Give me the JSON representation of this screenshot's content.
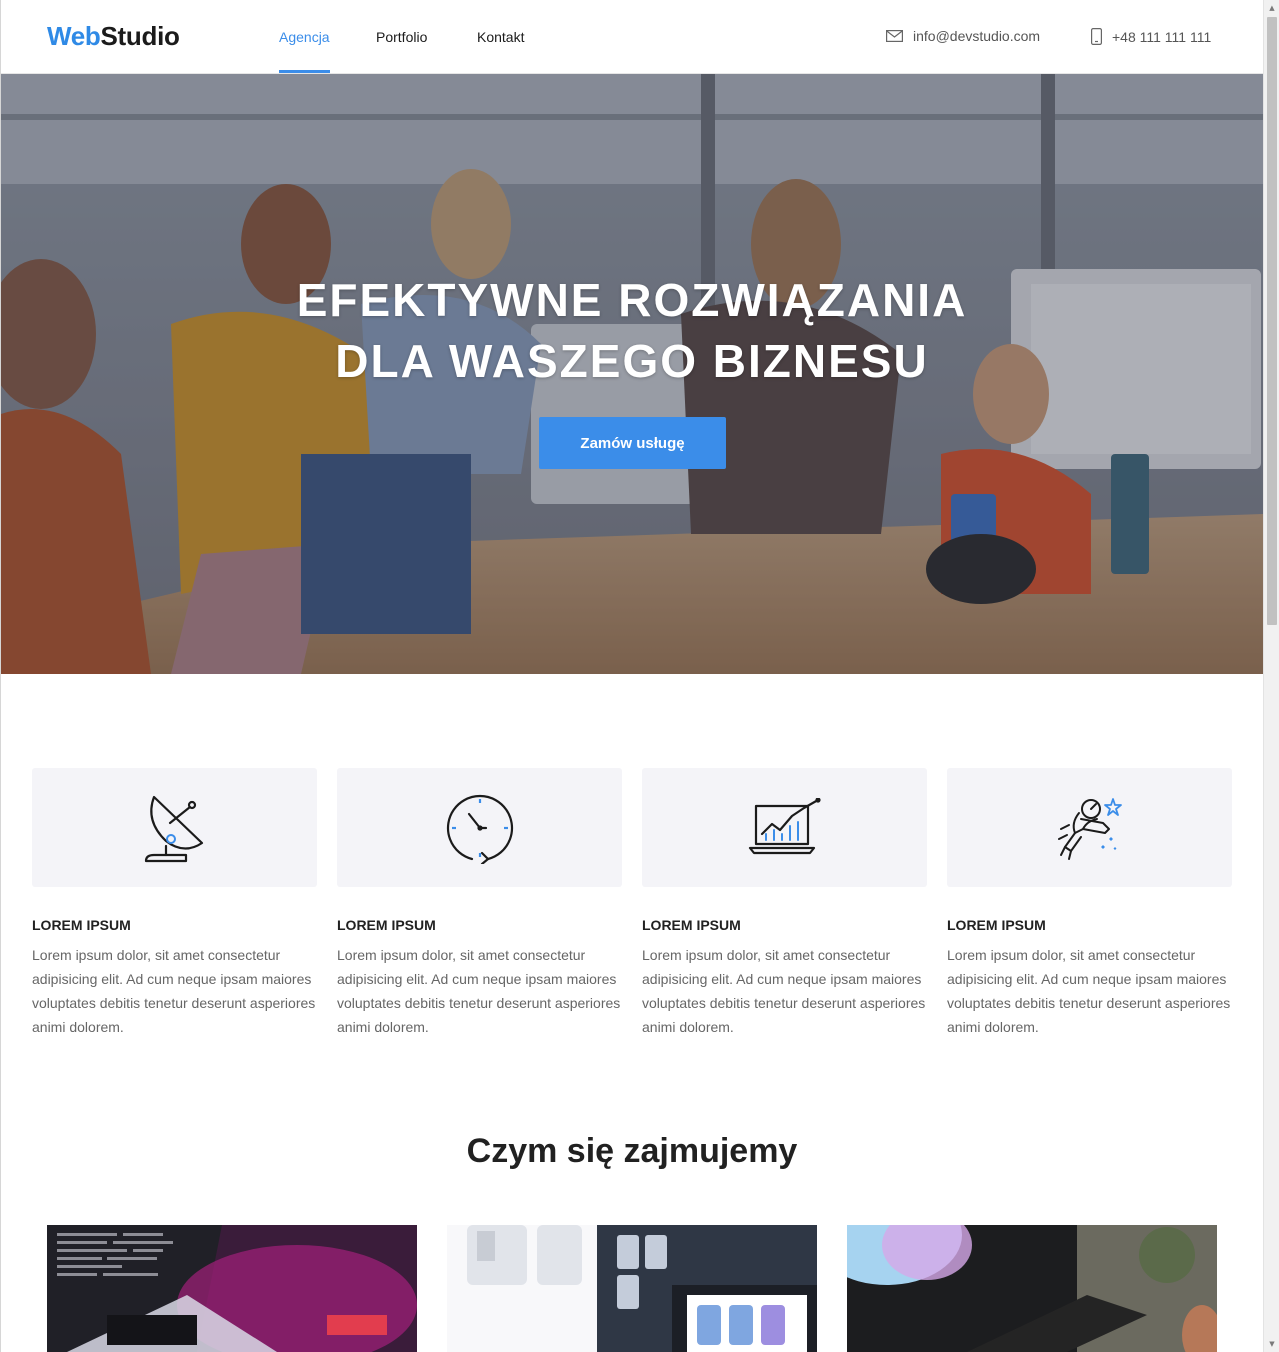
{
  "header": {
    "logo_part1": "Web",
    "logo_part2": "Studio",
    "nav": [
      {
        "label": "Agencja",
        "active": true
      },
      {
        "label": "Portfolio",
        "active": false
      },
      {
        "label": "Kontakt",
        "active": false
      }
    ],
    "email": "info@devstudio.com",
    "phone": "+48 111 111 111",
    "accent_color": "#3b8de9"
  },
  "hero": {
    "title_line1": "EFEKTYWNE ROZWIĄZANIA",
    "title_line2": "DLA WASZEGO BIZNESU",
    "button_label": "Zamów usługę"
  },
  "features": [
    {
      "icon": "satellite-dish-icon",
      "title": "LOREM IPSUM",
      "text": "Lorem ipsum dolor, sit amet consectetur adipisicing elit. Ad cum neque ipsam maiores voluptates debitis tenetur deserunt asperiores animi dolorem."
    },
    {
      "icon": "clock-refresh-icon",
      "title": "LOREM IPSUM",
      "text": "Lorem ipsum dolor, sit amet consectetur adipisicing elit. Ad cum neque ipsam maiores voluptates debitis tenetur deserunt asperiores animi dolorem."
    },
    {
      "icon": "laptop-chart-icon",
      "title": "LOREM IPSUM",
      "text": "Lorem ipsum dolor, sit amet consectetur adipisicing elit. Ad cum neque ipsam maiores voluptates debitis tenetur deserunt asperiores animi dolorem."
    },
    {
      "icon": "astronaut-rocket-icon",
      "title": "LOREM IPSUM",
      "text": "Lorem ipsum dolor, sit amet consectetur adipisicing elit. Ad cum neque ipsam maiores voluptates debitis tenetur deserunt asperiores animi dolorem."
    }
  ],
  "services": {
    "title": "Czym się zajmujemy"
  }
}
